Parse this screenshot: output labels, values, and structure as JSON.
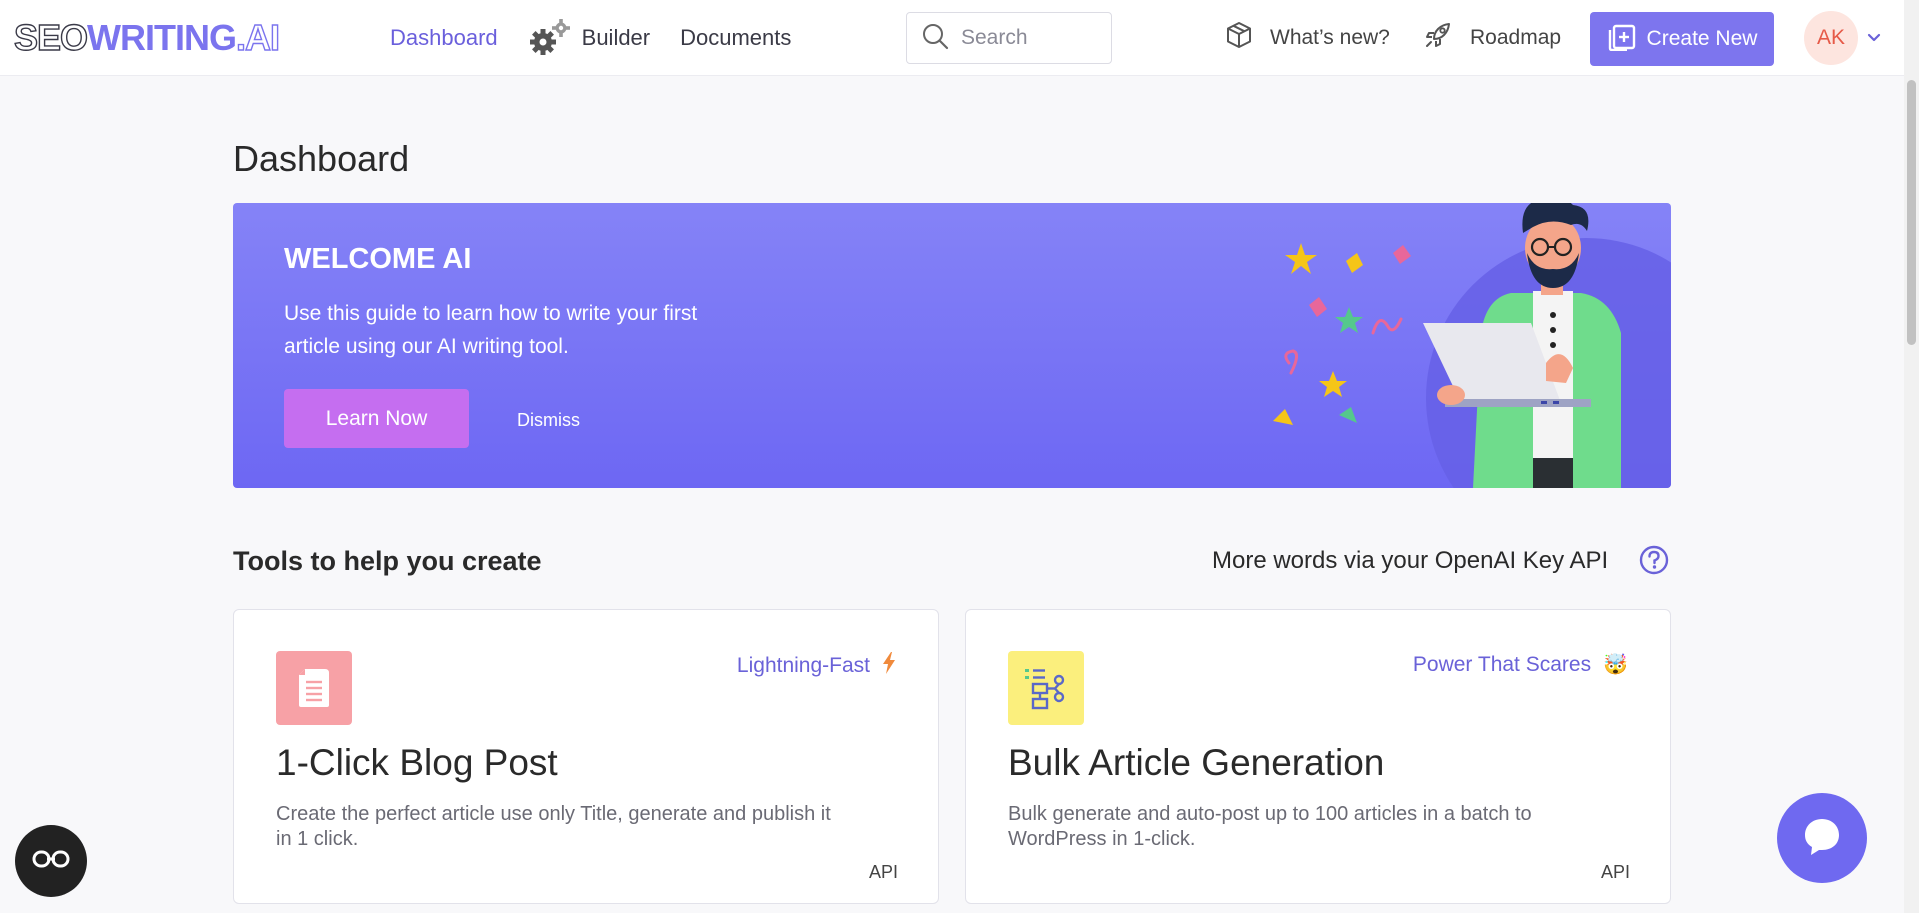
{
  "header": {
    "logo": {
      "seo": "SEO",
      "writing": "WRITING",
      "ai": ".AI"
    },
    "nav": [
      {
        "label": "Dashboard",
        "active": true
      },
      {
        "label": "Builder",
        "icon": "gears-icon"
      },
      {
        "label": "Documents"
      }
    ],
    "search": {
      "placeholder": "Search",
      "value": ""
    },
    "whats_new": {
      "label": "What’s new?",
      "icon": "box-icon"
    },
    "roadmap": {
      "label": "Roadmap",
      "icon": "rocket-icon"
    },
    "create_new": {
      "label": "Create New",
      "icon": "add-document-icon"
    },
    "avatar": {
      "initials": "AK"
    }
  },
  "page": {
    "title": "Dashboard"
  },
  "banner": {
    "title": "WELCOME AI",
    "text": "Use this guide to learn how to write your first article using our AI writing tool.",
    "learn_label": "Learn Now",
    "dismiss_label": "Dismiss"
  },
  "tools": {
    "title": "Tools to help you create",
    "api_link": "More words via your OpenAI Key API",
    "cards": [
      {
        "title": "1-Click Blog Post",
        "tag": "Lightning-Fast",
        "tag_icon": "lightning-icon",
        "description": "Create the perfect article use only Title, generate and publish it in 1 click.",
        "badge": "API",
        "icon": "document-icon",
        "icon_bg": "#f7a1a6"
      },
      {
        "title": "Bulk Article Generation",
        "tag": "Power That Scares",
        "tag_emoji": "🤯",
        "description": "Bulk generate and auto-post up to 100 articles in a batch to WordPress in 1-click.",
        "badge": "API",
        "icon": "flowchart-icon",
        "icon_bg": "#fbef7d"
      }
    ]
  },
  "colors": {
    "accent": "#7d75ee",
    "banner_top": "#8583f7",
    "banner_bottom": "#6d67f3",
    "learn_button": "#c56ef0"
  }
}
